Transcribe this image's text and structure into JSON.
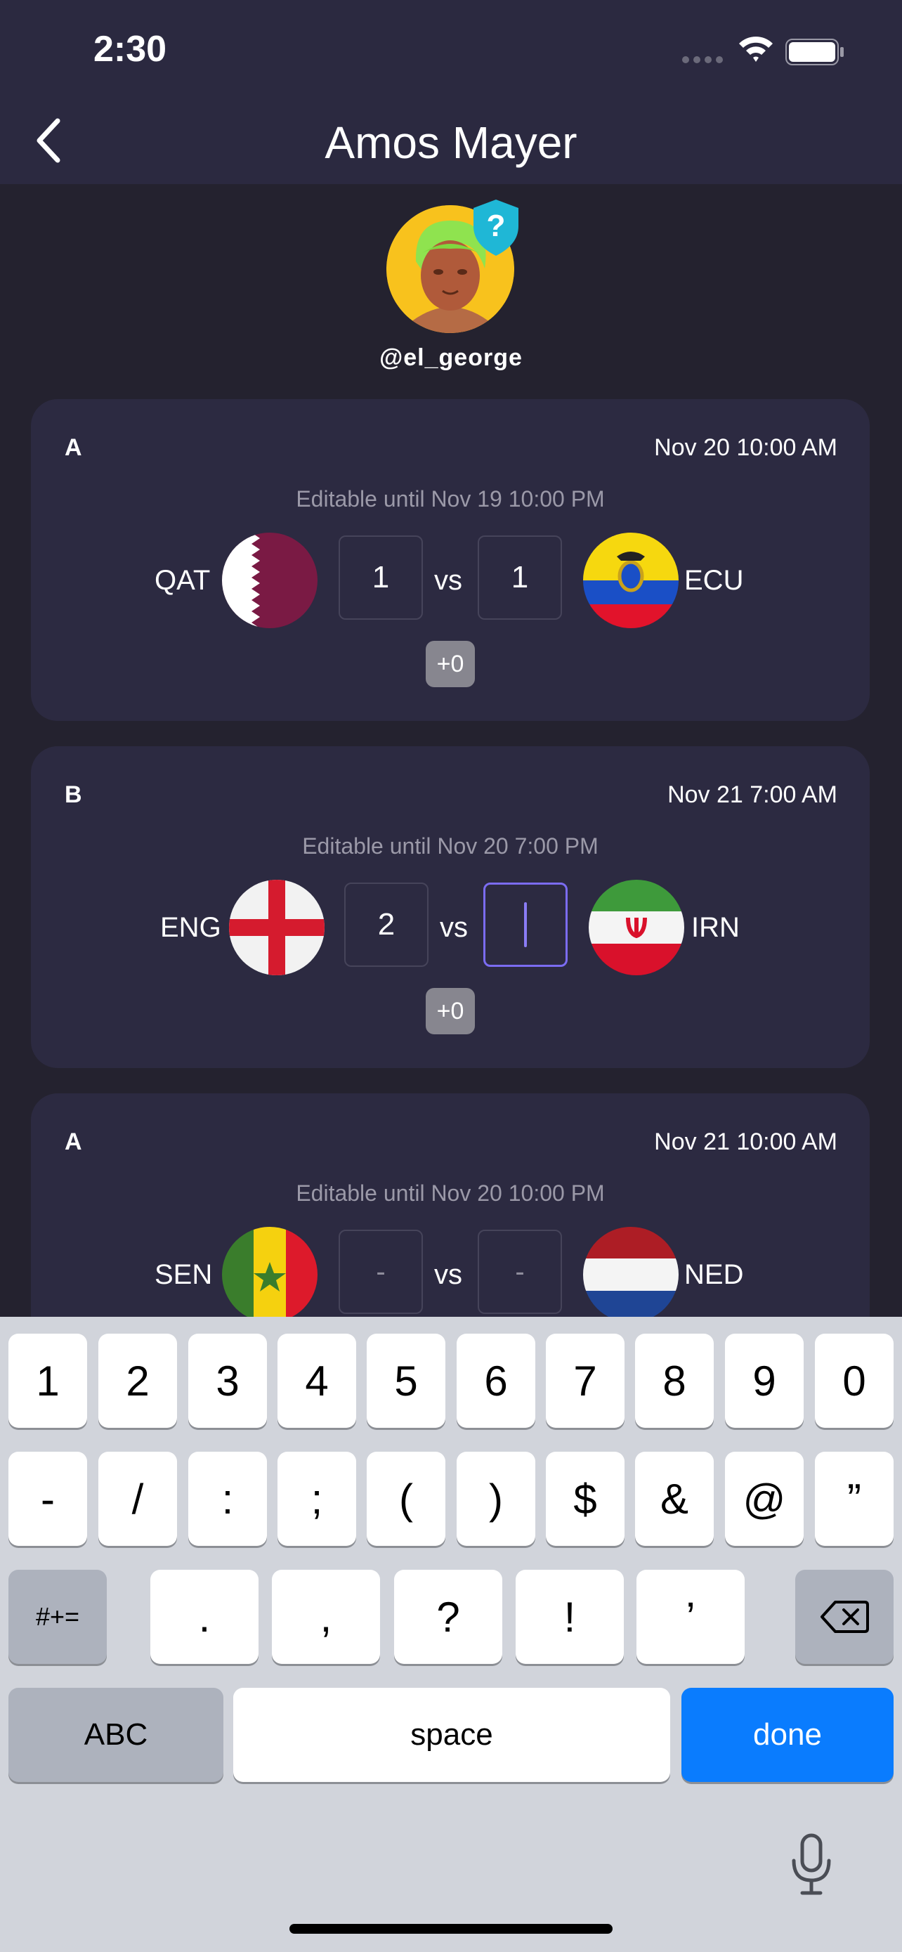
{
  "status_bar": {
    "time": "2:30"
  },
  "nav": {
    "title": "Amos Mayer"
  },
  "profile": {
    "username": "@el_george",
    "badge_icon": "question-shield-icon"
  },
  "matches": [
    {
      "group": "A",
      "date": "Nov 20 10:00 AM",
      "editable": "Editable until Nov 19 10:00 PM",
      "home_code": "QAT",
      "home_flag": "qatar-flag-icon",
      "home_score": "1",
      "vs": "vs",
      "away_score": "1",
      "away_code": "ECU",
      "away_flag": "ecuador-flag-icon",
      "points": "+0"
    },
    {
      "group": "B",
      "date": "Nov 21 7:00 AM",
      "editable": "Editable until Nov 20 7:00 PM",
      "home_code": "ENG",
      "home_flag": "england-flag-icon",
      "home_score": "2",
      "vs": "vs",
      "away_score": "",
      "away_code": "IRN",
      "away_flag": "iran-flag-icon",
      "points": "+0"
    },
    {
      "group": "A",
      "date": "Nov 21 10:00 AM",
      "editable": "Editable until Nov 20 10:00 PM",
      "home_code": "SEN",
      "home_flag": "senegal-flag-icon",
      "home_score": "-",
      "vs": "vs",
      "away_score": "-",
      "away_code": "NED",
      "away_flag": "netherlands-flag-icon"
    }
  ],
  "keyboard": {
    "row1": [
      "1",
      "2",
      "3",
      "4",
      "5",
      "6",
      "7",
      "8",
      "9",
      "0"
    ],
    "row2": [
      "-",
      "/",
      ":",
      ";",
      "(",
      ")",
      "$",
      "&",
      "@",
      "”"
    ],
    "row3_left": "#+=",
    "row3": [
      ".",
      ",",
      "?",
      "!",
      "’"
    ],
    "abc": "ABC",
    "space": "space",
    "done": "done"
  },
  "colors": {
    "background": "#24222f",
    "header": "#2b2940",
    "card": "#2c2a41",
    "active_border": "#7b6cf2",
    "done_key": "#0a7cfe"
  }
}
